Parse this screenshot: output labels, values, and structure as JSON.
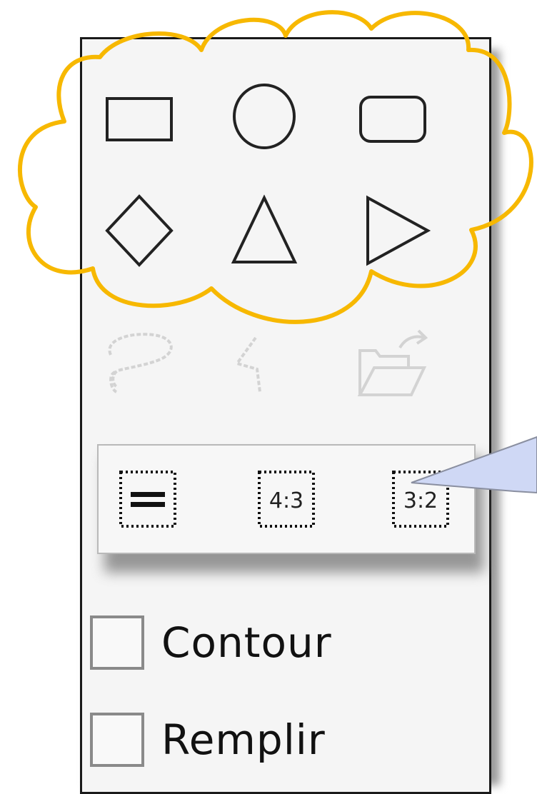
{
  "shapes": {
    "icons": [
      "rectangle-icon",
      "ellipse-icon",
      "rounded-rectangle-icon",
      "diamond-icon",
      "triangle-icon",
      "right-triangle-icon"
    ]
  },
  "disabled_tools": {
    "icons": [
      "freeform-lasso-icon",
      "polygon-icon",
      "open-folder-icon"
    ]
  },
  "ratio_popup": {
    "buttons": [
      {
        "icon": "equal-ratio-icon",
        "label": ""
      },
      {
        "icon": "ratio-4-3-icon",
        "label": "4:3"
      },
      {
        "icon": "ratio-3-2-icon",
        "label": "3:2"
      }
    ]
  },
  "options": {
    "contour_label": "Contour",
    "fill_label": "Remplir",
    "contour_checked": false,
    "fill_checked": false
  },
  "colors": {
    "highlight_cloud": "#f7b800",
    "callout_fill": "#cfd8f5",
    "callout_border": "#8a8fa0",
    "panel_border": "#1a1a1a",
    "disabled_icon": "#d3d3d3"
  }
}
